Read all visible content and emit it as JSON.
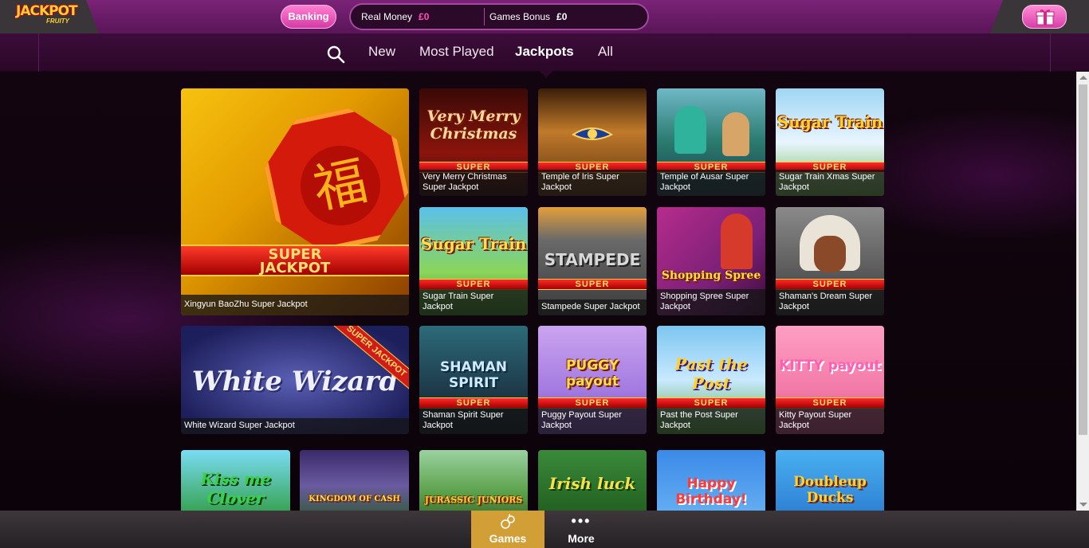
{
  "header": {
    "logo_text": "JACKPOT",
    "logo_sub": "FRUITY",
    "banking_label": "Banking",
    "real_money_label": "Real Money",
    "real_money_value": "£0",
    "games_bonus_label": "Games Bonus",
    "games_bonus_value": "£0"
  },
  "nav": {
    "items": [
      {
        "label": "New"
      },
      {
        "label": "Most Played"
      },
      {
        "label": "Jackpots",
        "active": true
      },
      {
        "label": "All"
      }
    ]
  },
  "featured": {
    "badge_line1": "SUPER",
    "badge_line2": "JACKPOT",
    "symbol": "福",
    "caption": "Xingyun BaoZhu Super Jackpot"
  },
  "tiles": [
    {
      "art_title": "Very Merry Christmas",
      "band": "SUPER",
      "caption": "Very Merry Christmas Super Jackpot"
    },
    {
      "art_title": "",
      "band": "SUPER",
      "caption": "Temple of Iris Super Jackpot"
    },
    {
      "art_title": "",
      "band": "SUPER",
      "caption": "Temple of Ausar Super Jackpot"
    },
    {
      "art_title": "Sugar Train",
      "band": "SUPER",
      "caption": "Sugar Train Xmas Super Jackpot"
    },
    {
      "art_title": "Sugar Train",
      "band": "SUPER",
      "caption": "Sugar Train Super Jackpot"
    },
    {
      "art_title": "STAMPEDE",
      "band": "SUPER",
      "caption": "Stampede Super Jackpot"
    },
    {
      "art_title": "Shopping Spree",
      "band": "SUPER",
      "caption": "Shopping Spree Super Jackpot"
    },
    {
      "art_title": "",
      "band": "SUPER",
      "caption": "Shaman's Dream Super Jackpot"
    },
    {
      "art_title": "White Wizard",
      "band": "SUPER JACKPOT",
      "caption": "White Wizard Super Jackpot"
    },
    {
      "art_title": "SHAMAN SPIRIT",
      "band": "SUPER",
      "caption": "Shaman Spirit Super Jackpot"
    },
    {
      "art_title": "PUGGY payout",
      "band": "SUPER",
      "caption": "Puggy Payout Super Jackpot"
    },
    {
      "art_title": "Past the Post",
      "band": "SUPER",
      "caption": "Past the Post Super Jackpot"
    },
    {
      "art_title": "KITTY payout",
      "band": "SUPER",
      "caption": "Kitty Payout Super Jackpot"
    },
    {
      "art_title": "Kiss me Clover",
      "band": "",
      "caption": ""
    },
    {
      "art_title": "KINGDOM OF CASH",
      "band": "",
      "caption": ""
    },
    {
      "art_title": "JURASSIC JUNIORS",
      "band": "",
      "caption": ""
    },
    {
      "art_title": "Irish luck",
      "band": "",
      "caption": ""
    },
    {
      "art_title": "Happy Birthday!",
      "band": "",
      "caption": ""
    },
    {
      "art_title": "Doubleup Ducks",
      "band": "",
      "caption": ""
    }
  ],
  "bottom": {
    "games_label": "Games",
    "more_label": "More"
  },
  "colors": {
    "header_purple": "#6a1c67",
    "banking_pink": "#e14db3",
    "money_pink": "#ff4fb8",
    "games_tab_gold": "#d19f35"
  },
  "icons": [
    "search-icon",
    "gift-icon",
    "games-icon",
    "more-icon"
  ]
}
